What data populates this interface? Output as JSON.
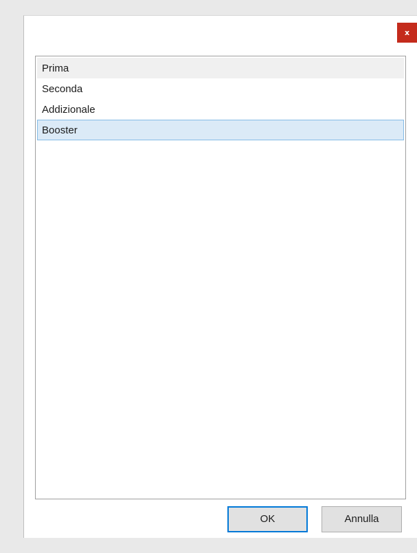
{
  "dialog": {
    "close_label": "x",
    "list": {
      "items": [
        {
          "label": "Prima",
          "state": "hover"
        },
        {
          "label": "Seconda",
          "state": "normal"
        },
        {
          "label": "Addizionale",
          "state": "normal"
        },
        {
          "label": "Booster",
          "state": "selected"
        }
      ]
    },
    "buttons": {
      "ok_label": "OK",
      "cancel_label": "Annulla"
    }
  },
  "colors": {
    "close_button": "#c42b1c",
    "selection_fill": "#dbeaf7",
    "selection_border": "#84bbe6",
    "default_button_border": "#0078d7"
  }
}
